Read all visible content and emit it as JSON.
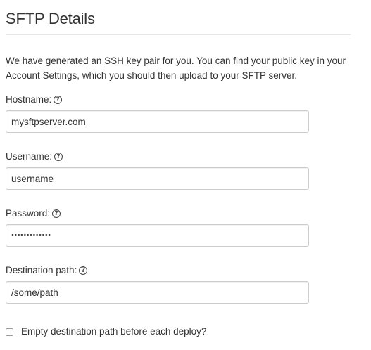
{
  "header": {
    "title": "SFTP Details"
  },
  "intro": {
    "text": "We have generated an SSH key pair for you. You can find your public key in your Account Settings, which you should then upload to your SFTP server."
  },
  "fields": {
    "hostname": {
      "label": "Hostname:",
      "value": "mysftpserver.com",
      "help_icon": "question-circle-icon"
    },
    "username": {
      "label": "Username:",
      "value": "username",
      "help_icon": "question-circle-icon"
    },
    "password": {
      "label": "Password:",
      "value": "•••••••••••••",
      "help_icon": "question-circle-icon"
    },
    "destination_path": {
      "label": "Destination path:",
      "value": "/some/path",
      "help_icon": "question-circle-icon"
    }
  },
  "options": {
    "empty_destination": {
      "label": "Empty destination path before each deploy?",
      "checked": false
    }
  },
  "colors": {
    "text": "#333333",
    "divider": "#e6e6e6",
    "input_border": "#cccccc"
  }
}
